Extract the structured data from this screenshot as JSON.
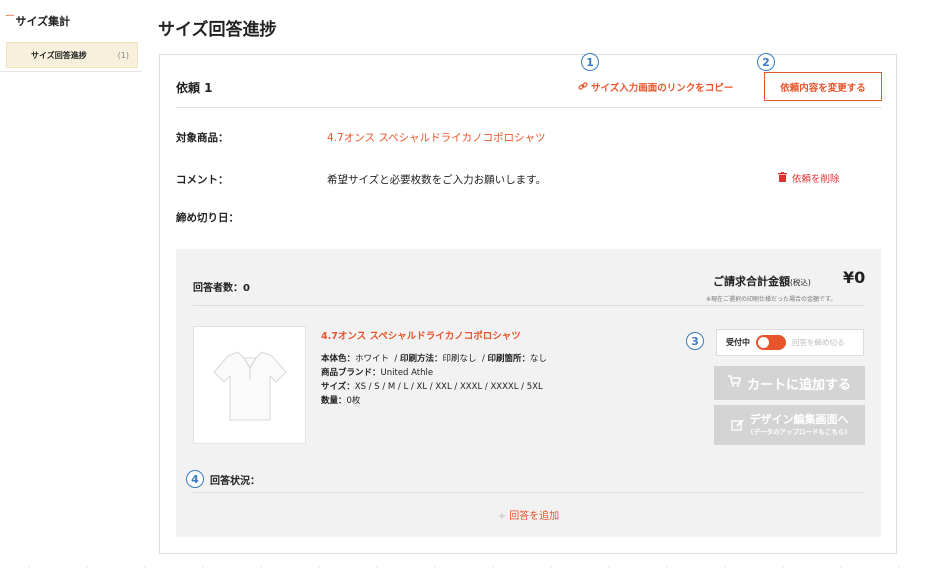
{
  "sidebar": {
    "title": "サイズ集計",
    "items": [
      {
        "label": "サイズ回答進捗",
        "count": "(1)"
      }
    ]
  },
  "page": {
    "title": "サイズ回答進捗"
  },
  "request": {
    "title": "依頼 1",
    "copy_link": "サイズ入力画面のリンクをコピー",
    "change_button": "依頼内容を変更する",
    "delete_link": "依頼を削除",
    "fields": {
      "product_label": "対象商品：",
      "product_value": "4.7オンス スペシャルドライカノコポロシャツ",
      "comment_label": "コメント：",
      "comment_value": "希望サイズと必要枚数をご入力お願いします。",
      "deadline_label": "締め切り日："
    }
  },
  "panel": {
    "respondents": "回答者数：0",
    "total_label": "ご請求合計金額",
    "total_tax": "(税込)",
    "total_value": "¥0",
    "total_note": "※現在ご選択の印刷仕様だった場合の金額です。",
    "product": {
      "name": "4.7オンス スペシャルドライカノコポロシャツ",
      "color_label": "本体色：",
      "color_value": "ホワイト",
      "method_label": "印刷方法：",
      "method_value": "印刷なし",
      "location_label": "印刷箇所：",
      "location_value": "なし",
      "brand_label": "商品ブランド：",
      "brand_value": "United Athle",
      "size_label": "サイズ：",
      "size_value": "XS / S / M / L / XL / XXL / XXXL / XXXXL / 5XL",
      "qty_label": "数量：",
      "qty_value": "0枚"
    },
    "status": {
      "accepting": "受付中",
      "close_label": "回答を締め切る",
      "toggle_on": true
    },
    "cart_button": "カートに追加する",
    "design_button": "デザイン編集画面へ",
    "design_button_sub": "(データのアップロードもこちら)",
    "response_status": "回答状況：",
    "add_response": "回答を追加"
  },
  "badges": [
    "1",
    "2",
    "3",
    "4"
  ],
  "colors": {
    "accent": "#e8552c",
    "badge": "#3a7cc1",
    "disabled": "#d4d4d4",
    "panel_bg": "#f2f2f2"
  }
}
